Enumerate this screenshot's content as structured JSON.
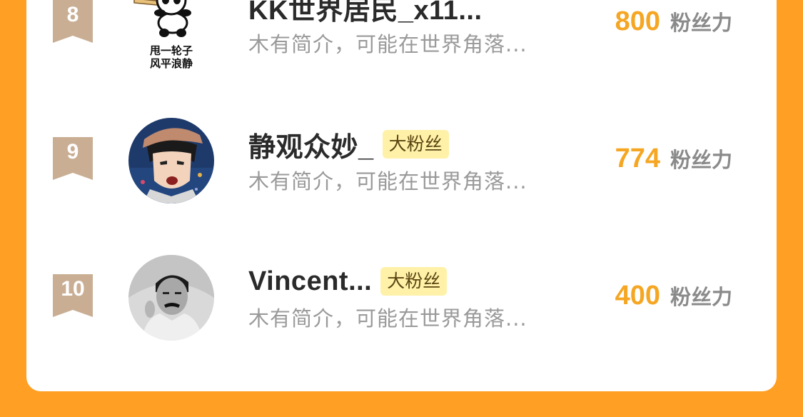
{
  "colors": {
    "background": "#FF9F24",
    "card": "#FFFFFF",
    "rank_badge": "#C9AE94",
    "score": "#F5A623",
    "fan_badge_bg": "#FFF1A8",
    "name": "#2A2A2A",
    "bio": "#9A9A9A"
  },
  "ranking": [
    {
      "rank": "8",
      "name": "KK世界居民_x11...",
      "badge": "",
      "bio": "木有简介，可能在世界角落...",
      "score": "800",
      "score_unit": "粉丝力",
      "avatar_icon": "panda-baseball-avatar-icon",
      "avatar_caption_1": "甩一轮子",
      "avatar_caption_2": "风平浪静"
    },
    {
      "rank": "9",
      "name": "静观众妙_",
      "badge": "大粉丝",
      "bio": "木有简介，可能在世界角落...",
      "score": "774",
      "score_unit": "粉丝力",
      "avatar_icon": "anime-boy-avatar-icon"
    },
    {
      "rank": "10",
      "name": "Vincent...",
      "badge": "大粉丝",
      "bio": "木有简介，可能在世界角落...",
      "score": "400",
      "score_unit": "粉丝力",
      "avatar_icon": "portrait-photo-avatar-icon"
    }
  ]
}
